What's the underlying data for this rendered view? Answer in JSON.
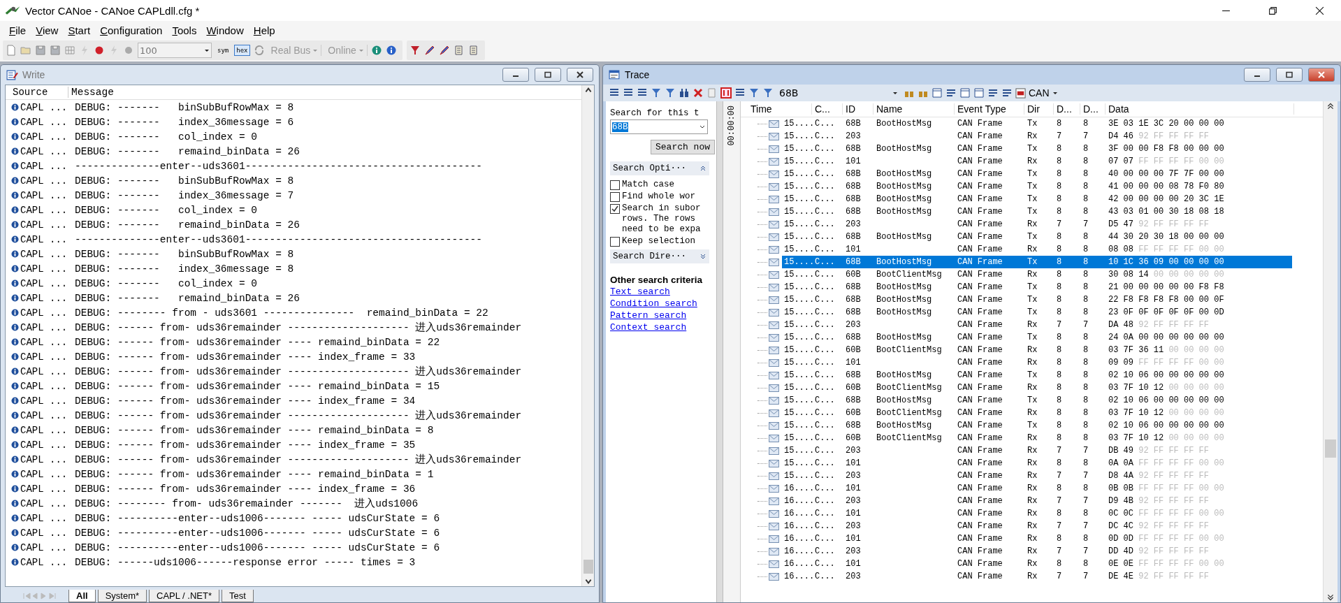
{
  "app": {
    "title": "Vector CANoe  - CANoe CAPLdll.cfg *"
  },
  "menu": [
    {
      "accel": "F",
      "rest": "ile"
    },
    {
      "accel": "V",
      "rest": "iew"
    },
    {
      "accel": "S",
      "rest": "tart"
    },
    {
      "accel": "C",
      "rest": "onfiguration"
    },
    {
      "accel": "T",
      "rest": "ools"
    },
    {
      "accel": "W",
      "rest": "indow"
    },
    {
      "accel": "H",
      "rest": "elp"
    }
  ],
  "toolbar": {
    "zoom": "100",
    "modes": [
      {
        "label": "sym",
        "pressed": false
      },
      {
        "label": "hex",
        "pressed": true
      }
    ],
    "bus": "Real Bus",
    "online": "Online"
  },
  "write": {
    "title": "Write",
    "columns": [
      "Source",
      "Message"
    ],
    "rows": [
      {
        "source": "CAPL ...",
        "message": "DEBUG: -------   binSubBufRowMax = 8"
      },
      {
        "source": "CAPL ...",
        "message": "DEBUG: -------   index_36message = 6"
      },
      {
        "source": "CAPL ...",
        "message": "DEBUG: -------   col_index = 0"
      },
      {
        "source": "CAPL ...",
        "message": "DEBUG: -------   remaind_binData = 26"
      },
      {
        "source": "CAPL ...",
        "message": "--------------enter--uds3601---------------------------------------"
      },
      {
        "source": "CAPL ...",
        "message": "DEBUG: -------   binSubBufRowMax = 8"
      },
      {
        "source": "CAPL ...",
        "message": "DEBUG: -------   index_36message = 7"
      },
      {
        "source": "CAPL ...",
        "message": "DEBUG: -------   col_index = 0"
      },
      {
        "source": "CAPL ...",
        "message": "DEBUG: -------   remaind_binData = 26"
      },
      {
        "source": "CAPL ...",
        "message": "--------------enter--uds3601---------------------------------------"
      },
      {
        "source": "CAPL ...",
        "message": "DEBUG: -------   binSubBufRowMax = 8"
      },
      {
        "source": "CAPL ...",
        "message": "DEBUG: -------   index_36message = 8"
      },
      {
        "source": "CAPL ...",
        "message": "DEBUG: -------   col_index = 0"
      },
      {
        "source": "CAPL ...",
        "message": "DEBUG: -------   remaind_binData = 26"
      },
      {
        "source": "CAPL ...",
        "message": "DEBUG: -------- from - uds3601 ---------------  remaind_binData = 22"
      },
      {
        "source": "CAPL ...",
        "message": "DEBUG: ------ from- uds36remainder -------------------- 进入uds36remainder"
      },
      {
        "source": "CAPL ...",
        "message": "DEBUG: ------ from- uds36remainder ---- remaind_binData = 22"
      },
      {
        "source": "CAPL ...",
        "message": "DEBUG: ------ from- uds36remainder ---- index_frame = 33"
      },
      {
        "source": "CAPL ...",
        "message": "DEBUG: ------ from- uds36remainder -------------------- 进入uds36remainder"
      },
      {
        "source": "CAPL ...",
        "message": "DEBUG: ------ from- uds36remainder ---- remaind_binData = 15"
      },
      {
        "source": "CAPL ...",
        "message": "DEBUG: ------ from- uds36remainder ---- index_frame = 34"
      },
      {
        "source": "CAPL ...",
        "message": "DEBUG: ------ from- uds36remainder -------------------- 进入uds36remainder"
      },
      {
        "source": "CAPL ...",
        "message": "DEBUG: ------ from- uds36remainder ---- remaind_binData = 8"
      },
      {
        "source": "CAPL ...",
        "message": "DEBUG: ------ from- uds36remainder ---- index_frame = 35"
      },
      {
        "source": "CAPL ...",
        "message": "DEBUG: ------ from- uds36remainder -------------------- 进入uds36remainder"
      },
      {
        "source": "CAPL ...",
        "message": "DEBUG: ------ from- uds36remainder ---- remaind_binData = 1"
      },
      {
        "source": "CAPL ...",
        "message": "DEBUG: ------ from- uds36remainder ---- index_frame = 36"
      },
      {
        "source": "CAPL ...",
        "message": "DEBUG: -------- from- uds36remainder -------  进入uds1006"
      },
      {
        "source": "CAPL ...",
        "message": "DEBUG: ----------enter--uds1006------- ----- udsCurState = 6"
      },
      {
        "source": "CAPL ...",
        "message": "DEBUG: ----------enter--uds1006------- ----- udsCurState = 6"
      },
      {
        "source": "CAPL ...",
        "message": "DEBUG: ----------enter--uds1006------- ----- udsCurState = 6"
      },
      {
        "source": "CAPL ...",
        "message": "DEBUG: ------uds1006------response error ----- times = 3"
      }
    ],
    "tabs": [
      {
        "label": "All",
        "selected": true
      },
      {
        "label": "System*",
        "selected": false
      },
      {
        "label": "CAPL / .NET*",
        "selected": false
      },
      {
        "label": "Test",
        "selected": false
      }
    ]
  },
  "trace": {
    "title": "Trace",
    "filter": "68B",
    "bus": "CAN",
    "search": {
      "prompt": "Search for this t",
      "value": "68B",
      "button": "Search now",
      "options_title": "Search Opti···",
      "options": [
        {
          "label": "Match case",
          "checked": false
        },
        {
          "label": "Find whole wor",
          "checked": false
        },
        {
          "label": "Search in subor rows. The rows need to be expa",
          "checked": true
        },
        {
          "label": "Keep selection",
          "checked": false
        }
      ],
      "direction_title": "Search Dire···",
      "other_title": "Other search criteria",
      "links": [
        "Text search",
        "Condition search",
        "Pattern search",
        "Context search"
      ]
    },
    "time_axis": "00:00:00",
    "columns": [
      "Time",
      "C...",
      "ID",
      "Name",
      "Event Type",
      "Dir",
      "D...",
      "D...",
      "Data"
    ],
    "rows": [
      {
        "time": "15....",
        "chan": "C...",
        "id": "68B",
        "name": "BootHostMsg",
        "type": "CAN Frame",
        "dir": "Tx",
        "dlc": "8",
        "len": "8",
        "data": "3E 03 1E 3C 20 00 00 00",
        "selected": false
      },
      {
        "time": "15....",
        "chan": "C...",
        "id": "203",
        "type": "CAN Frame",
        "dir": "Rx",
        "dlc": "7",
        "len": "7",
        "data": "D4 46",
        "data_dim": "92 FF FF FF FF",
        "selected": false
      },
      {
        "time": "15....",
        "chan": "C...",
        "id": "68B",
        "name": "BootHostMsg",
        "type": "CAN Frame",
        "dir": "Tx",
        "dlc": "8",
        "len": "8",
        "data": "3F 00 00 F8 F8 00 00 00",
        "selected": false
      },
      {
        "time": "15....",
        "chan": "C...",
        "id": "101",
        "type": "CAN Frame",
        "dir": "Rx",
        "dlc": "8",
        "len": "8",
        "data": "07 07",
        "data_dim": "FF FF FF FF 00 00",
        "selected": false
      },
      {
        "time": "15....",
        "chan": "C...",
        "id": "68B",
        "name": "BootHostMsg",
        "type": "CAN Frame",
        "dir": "Tx",
        "dlc": "8",
        "len": "8",
        "data": "40 00 00 00 7F 7F 00 00",
        "selected": false
      },
      {
        "time": "15....",
        "chan": "C...",
        "id": "68B",
        "name": "BootHostMsg",
        "type": "CAN Frame",
        "dir": "Tx",
        "dlc": "8",
        "len": "8",
        "data": "41 00 00 00 08 78 F0 80",
        "selected": false
      },
      {
        "time": "15....",
        "chan": "C...",
        "id": "68B",
        "name": "BootHostMsg",
        "type": "CAN Frame",
        "dir": "Tx",
        "dlc": "8",
        "len": "8",
        "data": "42 00 00 00 00 20 3C 1E",
        "selected": false
      },
      {
        "time": "15....",
        "chan": "C...",
        "id": "68B",
        "name": "BootHostMsg",
        "type": "CAN Frame",
        "dir": "Tx",
        "dlc": "8",
        "len": "8",
        "data": "43 03 01 00 30 18 08 18",
        "selected": false
      },
      {
        "time": "15....",
        "chan": "C...",
        "id": "203",
        "type": "CAN Frame",
        "dir": "Rx",
        "dlc": "7",
        "len": "7",
        "data": "D5 47",
        "data_dim": "92 FF FF FF FF",
        "selected": false
      },
      {
        "time": "15....",
        "chan": "C...",
        "id": "68B",
        "name": "BootHostMsg",
        "type": "CAN Frame",
        "dir": "Tx",
        "dlc": "8",
        "len": "8",
        "data": "44 30 20 30 18 00 00 00",
        "selected": false
      },
      {
        "time": "15....",
        "chan": "C...",
        "id": "101",
        "type": "CAN Frame",
        "dir": "Rx",
        "dlc": "8",
        "len": "8",
        "data": "08 08",
        "data_dim": "FF FF FF FF 00 00",
        "selected": false
      },
      {
        "time": "15....",
        "chan": "C...",
        "id": "68B",
        "name": "BootHostMsg",
        "type": "CAN Frame",
        "dir": "Tx",
        "dlc": "8",
        "len": "8",
        "data": "10 1C 36 09 00 00 00 00",
        "selected": true
      },
      {
        "time": "15....",
        "chan": "C...",
        "id": "60B",
        "name": "BootClientMsg",
        "type": "CAN Frame",
        "dir": "Rx",
        "dlc": "8",
        "len": "8",
        "data": "30 08 14",
        "data_dim": "00 00 00 00 00",
        "selected": false
      },
      {
        "time": "15....",
        "chan": "C...",
        "id": "68B",
        "name": "BootHostMsg",
        "type": "CAN Frame",
        "dir": "Tx",
        "dlc": "8",
        "len": "8",
        "data": "21 00 00 00 00 00 F8 F8",
        "selected": false
      },
      {
        "time": "15....",
        "chan": "C...",
        "id": "68B",
        "name": "BootHostMsg",
        "type": "CAN Frame",
        "dir": "Tx",
        "dlc": "8",
        "len": "8",
        "data": "22 F8 F8 F8 F8 00 00 0F",
        "selected": false
      },
      {
        "time": "15....",
        "chan": "C...",
        "id": "68B",
        "name": "BootHostMsg",
        "type": "CAN Frame",
        "dir": "Tx",
        "dlc": "8",
        "len": "8",
        "data": "23 0F 0F 0F 0F 0F 00 0D",
        "selected": false
      },
      {
        "time": "15....",
        "chan": "C...",
        "id": "203",
        "type": "CAN Frame",
        "dir": "Rx",
        "dlc": "7",
        "len": "7",
        "data": "DA 48",
        "data_dim": "92 FF FF FF FF",
        "selected": false
      },
      {
        "time": "15....",
        "chan": "C...",
        "id": "68B",
        "name": "BootHostMsg",
        "type": "CAN Frame",
        "dir": "Tx",
        "dlc": "8",
        "len": "8",
        "data": "24 0A 00 00 00 00 00 00",
        "selected": false
      },
      {
        "time": "15....",
        "chan": "C...",
        "id": "60B",
        "name": "BootClientMsg",
        "type": "CAN Frame",
        "dir": "Rx",
        "dlc": "8",
        "len": "8",
        "data": "03 7F 36 11",
        "data_dim": "00 00 00 00",
        "selected": false
      },
      {
        "time": "15....",
        "chan": "C...",
        "id": "101",
        "type": "CAN Frame",
        "dir": "Rx",
        "dlc": "8",
        "len": "8",
        "data": "09 09",
        "data_dim": "FF FF FF FF 00 00",
        "selected": false
      },
      {
        "time": "15....",
        "chan": "C...",
        "id": "68B",
        "name": "BootHostMsg",
        "type": "CAN Frame",
        "dir": "Tx",
        "dlc": "8",
        "len": "8",
        "data": "02 10 06 00 00 00 00 00",
        "selected": false
      },
      {
        "time": "15....",
        "chan": "C...",
        "id": "60B",
        "name": "BootClientMsg",
        "type": "CAN Frame",
        "dir": "Rx",
        "dlc": "8",
        "len": "8",
        "data": "03 7F 10 12",
        "data_dim": "00 00 00 00",
        "selected": false
      },
      {
        "time": "15....",
        "chan": "C...",
        "id": "68B",
        "name": "BootHostMsg",
        "type": "CAN Frame",
        "dir": "Tx",
        "dlc": "8",
        "len": "8",
        "data": "02 10 06 00 00 00 00 00",
        "selected": false
      },
      {
        "time": "15....",
        "chan": "C...",
        "id": "60B",
        "name": "BootClientMsg",
        "type": "CAN Frame",
        "dir": "Rx",
        "dlc": "8",
        "len": "8",
        "data": "03 7F 10 12",
        "data_dim": "00 00 00 00",
        "selected": false
      },
      {
        "time": "15....",
        "chan": "C...",
        "id": "68B",
        "name": "BootHostMsg",
        "type": "CAN Frame",
        "dir": "Tx",
        "dlc": "8",
        "len": "8",
        "data": "02 10 06 00 00 00 00 00",
        "selected": false
      },
      {
        "time": "15....",
        "chan": "C...",
        "id": "60B",
        "name": "BootClientMsg",
        "type": "CAN Frame",
        "dir": "Rx",
        "dlc": "8",
        "len": "8",
        "data": "03 7F 10 12",
        "data_dim": "00 00 00 00",
        "selected": false
      },
      {
        "time": "15....",
        "chan": "C...",
        "id": "203",
        "type": "CAN Frame",
        "dir": "Rx",
        "dlc": "7",
        "len": "7",
        "data": "DB 49",
        "data_dim": "92 FF FF FF FF",
        "selected": false
      },
      {
        "time": "15....",
        "chan": "C...",
        "id": "101",
        "type": "CAN Frame",
        "dir": "Rx",
        "dlc": "8",
        "len": "8",
        "data": "0A 0A",
        "data_dim": "FF FF FF FF 00 00",
        "selected": false
      },
      {
        "time": "15....",
        "chan": "C...",
        "id": "203",
        "type": "CAN Frame",
        "dir": "Rx",
        "dlc": "7",
        "len": "7",
        "data": "D8 4A",
        "data_dim": "92 FF FF FF FF",
        "selected": false
      },
      {
        "time": "16....",
        "chan": "C...",
        "id": "101",
        "type": "CAN Frame",
        "dir": "Rx",
        "dlc": "8",
        "len": "8",
        "data": "0B 0B",
        "data_dim": "FF FF FF FF 00 00",
        "selected": false
      },
      {
        "time": "16....",
        "chan": "C...",
        "id": "203",
        "type": "CAN Frame",
        "dir": "Rx",
        "dlc": "7",
        "len": "7",
        "data": "D9 4B",
        "data_dim": "92 FF FF FF FF",
        "selected": false
      },
      {
        "time": "16....",
        "chan": "C...",
        "id": "101",
        "type": "CAN Frame",
        "dir": "Rx",
        "dlc": "8",
        "len": "8",
        "data": "0C 0C",
        "data_dim": "FF FF FF FF 00 00",
        "selected": false
      },
      {
        "time": "16....",
        "chan": "C...",
        "id": "203",
        "type": "CAN Frame",
        "dir": "Rx",
        "dlc": "7",
        "len": "7",
        "data": "DC 4C",
        "data_dim": "92 FF FF FF FF",
        "selected": false
      },
      {
        "time": "16....",
        "chan": "C...",
        "id": "101",
        "type": "CAN Frame",
        "dir": "Rx",
        "dlc": "8",
        "len": "8",
        "data": "0D 0D",
        "data_dim": "FF FF FF FF 00 00",
        "selected": false
      },
      {
        "time": "16....",
        "chan": "C...",
        "id": "203",
        "type": "CAN Frame",
        "dir": "Rx",
        "dlc": "7",
        "len": "7",
        "data": "DD 4D",
        "data_dim": "92 FF FF FF FF",
        "selected": false
      },
      {
        "time": "16....",
        "chan": "C...",
        "id": "101",
        "type": "CAN Frame",
        "dir": "Rx",
        "dlc": "8",
        "len": "8",
        "data": "0E 0E",
        "data_dim": "FF FF FF FF 00 00",
        "selected": false
      },
      {
        "time": "16....",
        "chan": "C...",
        "id": "203",
        "type": "CAN Frame",
        "dir": "Rx",
        "dlc": "7",
        "len": "7",
        "data": "DE 4E",
        "data_dim": "92 FF FF FF FF",
        "selected": false
      }
    ]
  }
}
